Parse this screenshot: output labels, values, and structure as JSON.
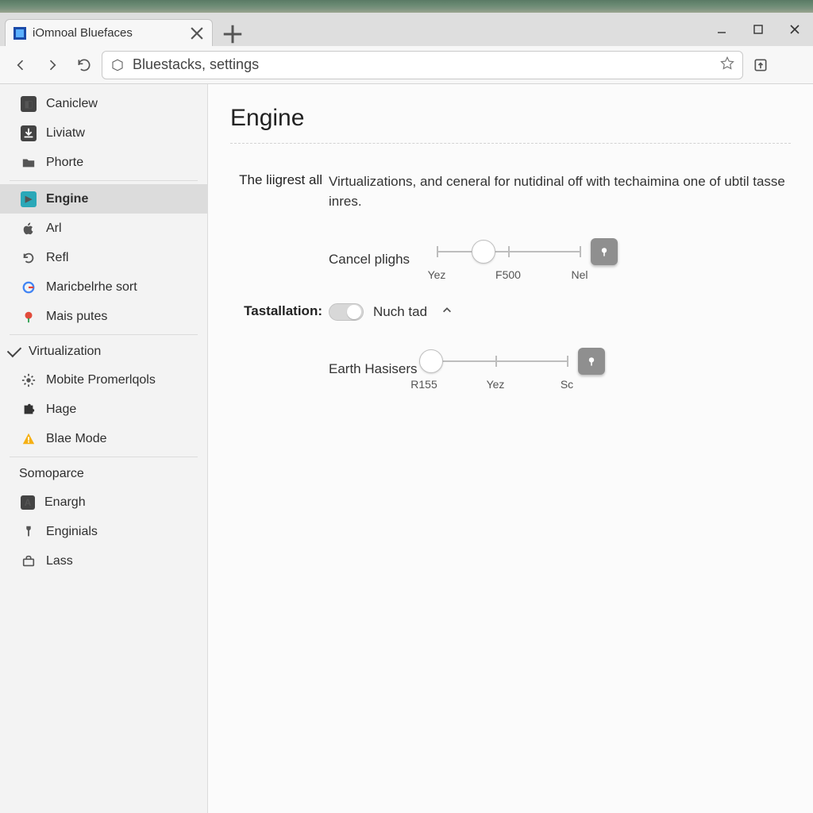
{
  "tab": {
    "title": "iOmnoal Bluefaces"
  },
  "address": {
    "url": "Bluestacks, settings"
  },
  "sidebar": {
    "group1": [
      {
        "label": "Caniclew"
      },
      {
        "label": "Liviatw"
      },
      {
        "label": "Phorte"
      }
    ],
    "group2": [
      {
        "label": "Engine",
        "selected": true
      },
      {
        "label": "Arl"
      },
      {
        "label": "Refl"
      },
      {
        "label": "Maricbelrhe sort"
      },
      {
        "label": "Mais putes"
      }
    ],
    "virt_header": "Virtualization",
    "group3": [
      {
        "label": "Mobite Promerlqols"
      },
      {
        "label": "Hage"
      },
      {
        "label": "Blae Mode"
      }
    ],
    "somo_header": "Somoparce",
    "group4": [
      {
        "label": "Enargh"
      },
      {
        "label": "Enginials"
      },
      {
        "label": "Lass"
      }
    ]
  },
  "page": {
    "title": "Engine",
    "intro_label": "The liigrest all",
    "intro_text": "Virtualizations, and ceneral for nutidinal off with techaimina one of ubtil tasse inres.",
    "slider1": {
      "label": "Cancel plighs",
      "ticks": [
        "Yez",
        "F500",
        "Nel"
      ],
      "thumb_pct": 33
    },
    "tastallation": {
      "label": "Tastallation:",
      "value": "Nuch tad"
    },
    "slider2": {
      "label": "Earth Hasisers",
      "ticks": [
        "R155",
        "Yez",
        "Sc"
      ],
      "thumb_pct": 5
    }
  }
}
